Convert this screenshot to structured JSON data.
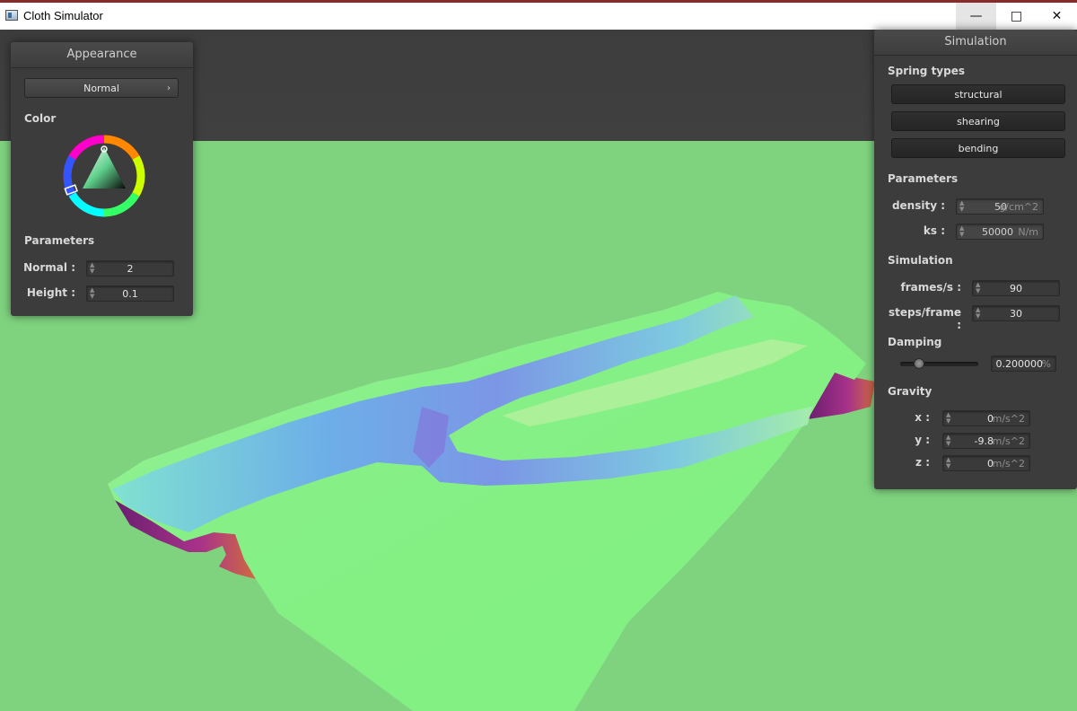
{
  "window": {
    "title": "Cloth Simulator",
    "min_icon": "minimize-icon",
    "max_icon": "maximize-icon",
    "close_icon": "close-icon"
  },
  "colors": {
    "background": "#7fd37f",
    "panel": "#3c3c3c",
    "cloth_green": "#86f086",
    "cloth_blue": "#6aa0f0",
    "cloth_purple": "#8a2c8a"
  },
  "appearance": {
    "title": "Appearance",
    "shader_select": "Normal",
    "color_label": "Color",
    "params_label": "Parameters",
    "normal_label": "Normal :",
    "normal_value": "2",
    "height_label": "Height :",
    "height_value": "0.1"
  },
  "simulation": {
    "title": "Simulation",
    "spring_types_label": "Spring types",
    "spring_buttons": [
      "structural",
      "shearing",
      "bending"
    ],
    "parameters_label": "Parameters",
    "density_label": "density :",
    "density_value": "50",
    "density_unit": "g/cm^2",
    "ks_label": "ks :",
    "ks_value": "50000",
    "ks_unit": "N/m",
    "simulation_label": "Simulation",
    "fps_label": "frames/s :",
    "fps_value": "90",
    "steps_label": "steps/frame :",
    "steps_value": "30",
    "damping_label": "Damping",
    "damping_value": "0.200000",
    "damping_unit": "%",
    "damping_fraction": 0.2,
    "gravity_label": "Gravity",
    "gx_label": "x :",
    "gx_value": "0",
    "gy_label": "y :",
    "gy_value": "-9.8",
    "gz_label": "z :",
    "gz_value": "0",
    "gravity_unit": "m/s^2"
  }
}
